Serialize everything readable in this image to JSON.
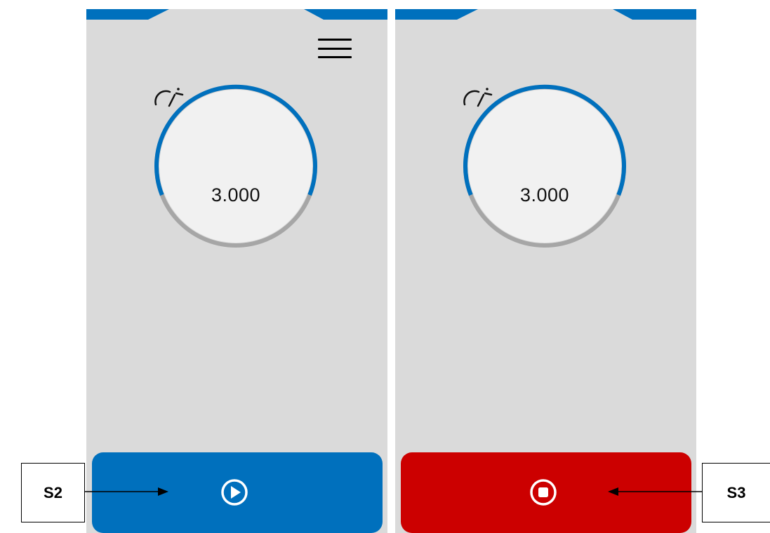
{
  "colors": {
    "accent_blue": "#0070bd",
    "stop_red": "#cc0000",
    "screen_bg": "#dadada",
    "gauge_track": "#a6a6a6"
  },
  "screens": [
    {
      "menu_icon": "hamburger-menu-icon",
      "gauge": {
        "icon": "speedometer-icon",
        "value": "3.000",
        "fill_fraction": 0.63
      },
      "button": {
        "icon": "play-circle-icon",
        "state": "start"
      }
    },
    {
      "gauge": {
        "icon": "speedometer-icon",
        "value": "3.000",
        "fill_fraction": 0.63
      },
      "button": {
        "icon": "stop-circle-icon",
        "state": "stop"
      }
    }
  ],
  "callouts": {
    "s2": "S2",
    "s3": "S3"
  }
}
